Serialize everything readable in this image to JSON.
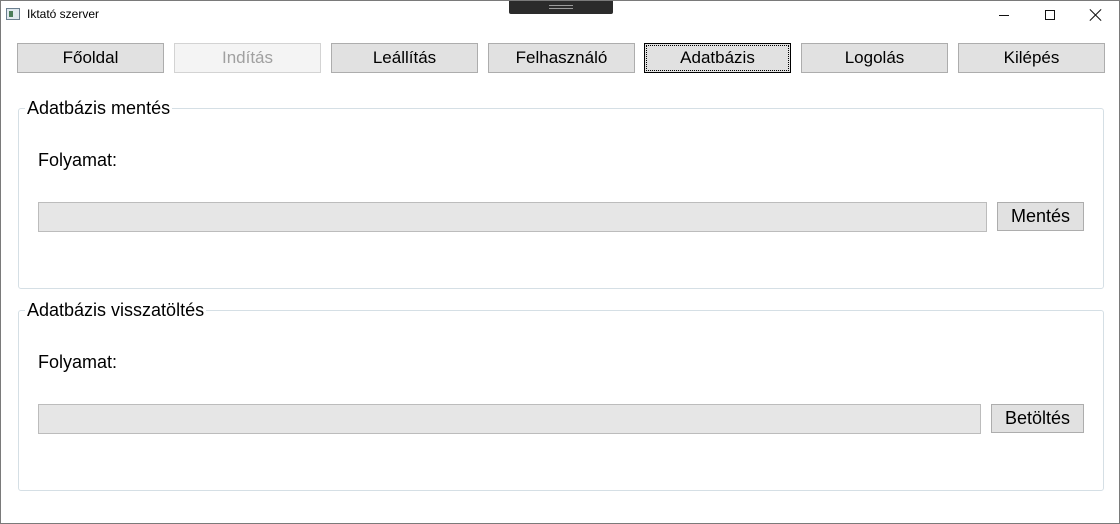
{
  "window": {
    "title": "Iktató szerver"
  },
  "nav": {
    "items": [
      {
        "label": "Főoldal",
        "state": "normal"
      },
      {
        "label": "Indítás",
        "state": "disabled"
      },
      {
        "label": "Leállítás",
        "state": "normal"
      },
      {
        "label": "Felhasználó",
        "state": "normal"
      },
      {
        "label": "Adatbázis",
        "state": "focused"
      },
      {
        "label": "Logolás",
        "state": "normal"
      },
      {
        "label": "Kilépés",
        "state": "normal"
      }
    ]
  },
  "backup": {
    "title": "Adatbázis mentés",
    "progress_label": "Folyamat:",
    "progress": 0,
    "button_label": "Mentés"
  },
  "restore": {
    "title": "Adatbázis visszatöltés",
    "progress_label": "Folyamat:",
    "progress": 0,
    "button_label": "Betöltés"
  },
  "icons": {
    "app": "app-window-icon",
    "minimize": "minimize-icon",
    "maximize": "maximize-icon",
    "close": "close-icon"
  }
}
